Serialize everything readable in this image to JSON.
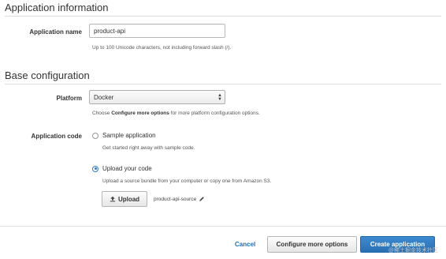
{
  "app_info": {
    "title": "Application information",
    "name_label": "Application name",
    "name_value": "product-api",
    "name_help": "Up to 100 Unicode characters, not including forward slash (/)."
  },
  "base_config": {
    "title": "Base configuration",
    "platform_label": "Platform",
    "platform_value": "Docker",
    "platform_help_prefix": "Choose ",
    "platform_help_bold": "Configure more options",
    "platform_help_suffix": " for more platform configuration options.",
    "app_code_label": "Application code",
    "sample_option": "Sample application",
    "sample_help": "Get started right away with sample code.",
    "upload_option": "Upload your code",
    "upload_help": "Upload a source bundle from your computer or copy one from Amazon S3.",
    "upload_button": "Upload",
    "file_name": "product-api-source"
  },
  "footer": {
    "cancel": "Cancel",
    "configure": "Configure more options",
    "create": "Create application"
  },
  "watermark": "@稀土掘金技术社区"
}
